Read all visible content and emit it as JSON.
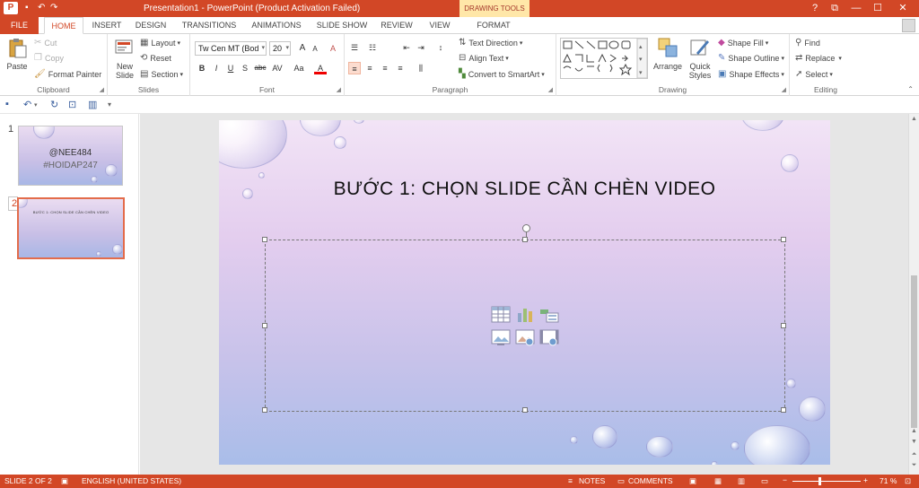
{
  "titlebar": {
    "logo": "P",
    "qat_icons": [
      "save-icon",
      "undo-icon",
      "redo-icon"
    ],
    "title": "Presentation1 - PowerPoint (Product Activation Failed)",
    "contextual_tab_group": "DRAWING TOOLS",
    "help": "?",
    "restore_ribbon": "⧉",
    "minimize": "—",
    "maximize": "☐",
    "close": "✕"
  },
  "tabs": {
    "file": "FILE",
    "items": [
      "HOME",
      "INSERT",
      "DESIGN",
      "TRANSITIONS",
      "ANIMATIONS",
      "SLIDE SHOW",
      "REVIEW",
      "VIEW",
      "FORMAT"
    ],
    "active": "HOME"
  },
  "ribbon": {
    "clipboard": {
      "label": "Clipboard",
      "paste": "Paste",
      "cut": "Cut",
      "copy": "Copy",
      "format_painter": "Format Painter"
    },
    "slides": {
      "label": "Slides",
      "new_slide_1": "New",
      "new_slide_2": "Slide",
      "layout": "Layout",
      "reset": "Reset",
      "section": "Section"
    },
    "font": {
      "label": "Font",
      "font_name": "Tw Cen MT (Bod",
      "font_size": "20",
      "bold": "B",
      "italic": "I",
      "underline": "U",
      "shadow": "S",
      "strike": "abc",
      "spacing": "AV",
      "case": "Aa",
      "color": "A",
      "grow": "A",
      "shrink": "A",
      "clear": "A"
    },
    "paragraph": {
      "label": "Paragraph",
      "text_direction": "Text Direction",
      "align_text": "Align Text",
      "convert_smartart": "Convert to SmartArt"
    },
    "drawing": {
      "label": "Drawing",
      "arrange": "Arrange",
      "quick_styles_1": "Quick",
      "quick_styles_2": "Styles",
      "shape_fill": "Shape Fill",
      "shape_outline": "Shape Outline",
      "shape_effects": "Shape Effects"
    },
    "editing": {
      "label": "Editing",
      "find": "Find",
      "replace": "Replace",
      "select": "Select"
    }
  },
  "thumbnails": {
    "slides": [
      {
        "number": "1",
        "line1": "@NEE484",
        "line2": "#HOIDAP247"
      },
      {
        "number": "2",
        "line1": "BƯỚC 1: CHỌN SLIDE CẦN CHÈN VIDEO"
      }
    ]
  },
  "slide": {
    "title": "BƯỚC 1: CHỌN SLIDE CẦN CHÈN VIDEO"
  },
  "status": {
    "slide_info": "SLIDE 2 OF 2",
    "language": "ENGLISH (UNITED STATES)",
    "notes": "NOTES",
    "comments": "COMMENTS",
    "zoom": "71 %",
    "zoom_fraction": 0.4
  },
  "colors": {
    "accent": "#d24726",
    "contextual": "#ffe7a8"
  }
}
